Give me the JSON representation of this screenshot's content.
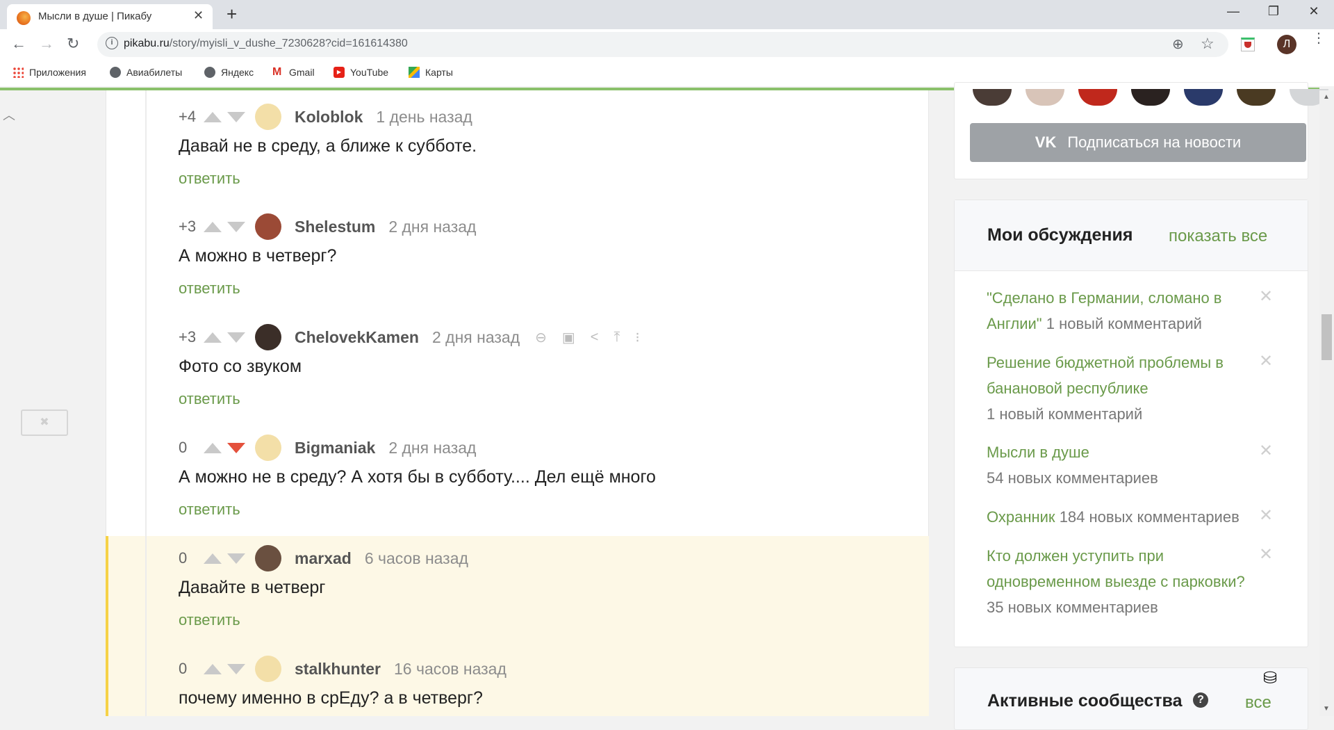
{
  "browser": {
    "tab_title": "Мысли в душе | Пикабу",
    "url_host": "pikabu.ru",
    "url_path": "/story/myisli_v_dushe_7230628?cid=161614380",
    "profile_initial": "Л",
    "bookmarks": [
      {
        "label": "Приложения",
        "icon": "apps-grid-icon"
      },
      {
        "label": "Авиабилеты",
        "icon": "globe-icon"
      },
      {
        "label": "Яндекс",
        "icon": "globe-icon"
      },
      {
        "label": "Gmail",
        "icon": "gmail-icon"
      },
      {
        "label": "YouTube",
        "icon": "youtube-icon"
      },
      {
        "label": "Карты",
        "icon": "maps-icon"
      }
    ]
  },
  "comments": [
    {
      "rating": "+4",
      "author": "Koloblok",
      "time": "1 день назад",
      "text": "Давай не в среду, а ближе к субботе.",
      "reply": "ответить",
      "vote": "none",
      "avatar_color": "#f3dfa8"
    },
    {
      "rating": "+3",
      "author": "Shelestum",
      "time": "2 дня назад",
      "text": "А можно в четверг?",
      "reply": "ответить",
      "vote": "none",
      "avatar_color": "#9b4a36"
    },
    {
      "rating": "+3",
      "author": "ChelovekKamen",
      "time": "2 дня назад",
      "text": "Фото со звуком",
      "reply": "ответить",
      "vote": "none",
      "avatar_color": "#3b2e28",
      "tools": [
        "link-icon",
        "save-icon",
        "share-icon",
        "scroll-up-icon",
        "more-icon"
      ]
    },
    {
      "rating": "0",
      "author": "Bigmaniak",
      "time": "2 дня назад",
      "text": "А можно не в среду? А хотя бы в субботу.... Дел ещё много",
      "reply": "ответить",
      "vote": "down",
      "avatar_color": "#f3dfa8"
    },
    {
      "rating": "0",
      "author": "marxad",
      "time": "6 часов назад",
      "text": "Давайте в четверг",
      "reply": "ответить",
      "vote": "none",
      "avatar_color": "#6a5040",
      "highlighted": true
    },
    {
      "rating": "0",
      "author": "stalkhunter",
      "time": "16 часов назад",
      "text": "почему именно в срЕду? а в четверг?",
      "reply": "ответить",
      "vote": "none",
      "avatar_color": "#f3dfa8",
      "highlighted": true
    }
  ],
  "sidebar": {
    "subscribe_button": "Подписаться на новости",
    "subscriber_avatar_colors": [
      "#4a3c36",
      "#d8c4b8",
      "#c0281c",
      "#2a2220",
      "#2a3a6a",
      "#4a3a22",
      "#d4d6d8"
    ],
    "discussions": {
      "title": "Мои обсуждения",
      "show_all": "показать все",
      "items": [
        {
          "title": "\"Сделано в Германии, сломано в Англии\"",
          "count": "1 новый комментарий"
        },
        {
          "title": "Решение бюджетной проблемы в банановой республике",
          "count": "1 новый комментарий"
        },
        {
          "title": "Мысли в душе",
          "count": "54 новых комментариев"
        },
        {
          "title": "Охранник",
          "count": "184 новых комментариев"
        },
        {
          "title": "Кто должен уступить при одновременном выезде с парковки?",
          "count": "35 новых комментариев"
        }
      ]
    },
    "communities": {
      "title": "Активные сообщества",
      "all_link": "все"
    }
  },
  "colors": {
    "accent_green": "#6a9a4a",
    "downvote_red": "#e4513c",
    "highlight_bg": "#fdf8e6",
    "highlight_border": "#f6d247"
  }
}
